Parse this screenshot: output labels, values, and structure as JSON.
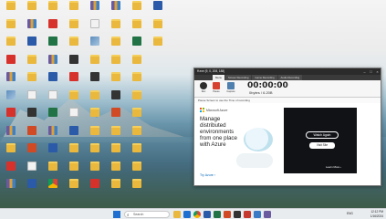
{
  "desktop": {
    "icons": [
      {
        "label": "",
        "kind": "folder"
      },
      {
        "label": "",
        "kind": "folder"
      },
      {
        "label": "",
        "kind": "folder"
      },
      {
        "label": "",
        "kind": "pdf"
      },
      {
        "label": "",
        "kind": "zip"
      },
      {
        "label": "",
        "kind": "img"
      },
      {
        "label": "",
        "kind": "pdf"
      },
      {
        "label": "",
        "kind": "zip"
      },
      {
        "label": "",
        "kind": "folder"
      },
      {
        "label": "",
        "kind": "pdf"
      },
      {
        "label": "",
        "kind": "zip"
      },
      {
        "label": "",
        "kind": "folder"
      },
      {
        "label": "",
        "kind": "zip"
      },
      {
        "label": "",
        "kind": "doc"
      },
      {
        "label": "",
        "kind": "folder"
      },
      {
        "label": "",
        "kind": "folder"
      },
      {
        "label": "",
        "kind": "blank"
      },
      {
        "label": "",
        "kind": "app"
      },
      {
        "label": "",
        "kind": "ppt"
      },
      {
        "label": "",
        "kind": "ppt"
      },
      {
        "label": "",
        "kind": "blank"
      },
      {
        "label": "",
        "kind": "doc"
      },
      {
        "label": "",
        "kind": "folder"
      },
      {
        "label": "",
        "kind": "pdf"
      },
      {
        "label": "",
        "kind": "xls"
      },
      {
        "label": "",
        "kind": "zip"
      },
      {
        "label": "",
        "kind": "doc"
      },
      {
        "label": "",
        "kind": "blank"
      },
      {
        "label": "",
        "kind": "xls"
      },
      {
        "label": "",
        "kind": "zip"
      },
      {
        "label": "",
        "kind": "doc"
      },
      {
        "label": "",
        "kind": "folder"
      },
      {
        "label": "",
        "kind": "chrome"
      },
      {
        "label": "",
        "kind": "folder"
      },
      {
        "label": "",
        "kind": "folder"
      },
      {
        "label": "",
        "kind": "folder"
      },
      {
        "label": "",
        "kind": "app"
      },
      {
        "label": "",
        "kind": "pdf"
      },
      {
        "label": "",
        "kind": "folder"
      },
      {
        "label": "",
        "kind": "blank"
      },
      {
        "label": "",
        "kind": "doc"
      },
      {
        "label": "",
        "kind": "folder"
      },
      {
        "label": "",
        "kind": "folder"
      },
      {
        "label": "",
        "kind": "folder"
      },
      {
        "label": "",
        "kind": "zip"
      },
      {
        "label": "",
        "kind": "blank"
      },
      {
        "label": "",
        "kind": "img"
      },
      {
        "label": "",
        "kind": "folder"
      },
      {
        "label": "",
        "kind": "app"
      },
      {
        "label": "",
        "kind": "folder"
      },
      {
        "label": "",
        "kind": "folder"
      },
      {
        "label": "",
        "kind": "folder"
      },
      {
        "label": "",
        "kind": "folder"
      },
      {
        "label": "",
        "kind": "folder"
      },
      {
        "label": "",
        "kind": "pdf"
      },
      {
        "label": "",
        "kind": "zip"
      },
      {
        "label": "",
        "kind": "folder"
      },
      {
        "label": "",
        "kind": "folder"
      },
      {
        "label": "",
        "kind": "folder"
      },
      {
        "label": "",
        "kind": "folder"
      },
      {
        "label": "",
        "kind": "app"
      },
      {
        "label": "",
        "kind": "ppt"
      },
      {
        "label": "",
        "kind": "folder"
      },
      {
        "label": "",
        "kind": "folder"
      },
      {
        "label": "",
        "kind": "folder"
      },
      {
        "label": "",
        "kind": "folder"
      },
      {
        "label": "",
        "kind": "folder"
      },
      {
        "label": "",
        "kind": "folder"
      },
      {
        "label": "",
        "kind": "xls"
      },
      {
        "label": "",
        "kind": "folder"
      },
      {
        "label": "",
        "kind": "folder"
      },
      {
        "label": "",
        "kind": "folder"
      },
      {
        "label": "",
        "kind": "folder"
      },
      {
        "label": "",
        "kind": "folder"
      },
      {
        "label": "",
        "kind": "folder"
      },
      {
        "label": "",
        "kind": "folder"
      },
      {
        "label": "",
        "kind": "folder"
      },
      {
        "label": "",
        "kind": "doc"
      },
      {
        "label": "",
        "kind": "folder"
      },
      {
        "label": "",
        "kind": "folder"
      }
    ]
  },
  "recorder": {
    "title": "ff.exe (9, 0, 208, 188)",
    "tabs": [
      "Menu",
      "Screen Recording",
      "Game Recording",
      "Audio Recording"
    ],
    "toolbar": {
      "record": "Rec",
      "pause": "Pause",
      "screenshot": "Capture"
    },
    "timer": "00:00:00",
    "size": "0bytes / 6.20B",
    "status": "Pause Screen to use the Time of recording",
    "ad": {
      "brand": "Microsoft Azure",
      "headline": "Manage distributed environments from one place with Azure",
      "cta": "Try Azure ›",
      "watch": "Watch Again",
      "visit": "Visit Site",
      "learn": "Learn More ›",
      "audio": "Audio Recording"
    }
  },
  "taskbar": {
    "search_placeholder": "Search",
    "lang": "ENG",
    "time": "12:12 PM",
    "date": "1/16/2024"
  }
}
